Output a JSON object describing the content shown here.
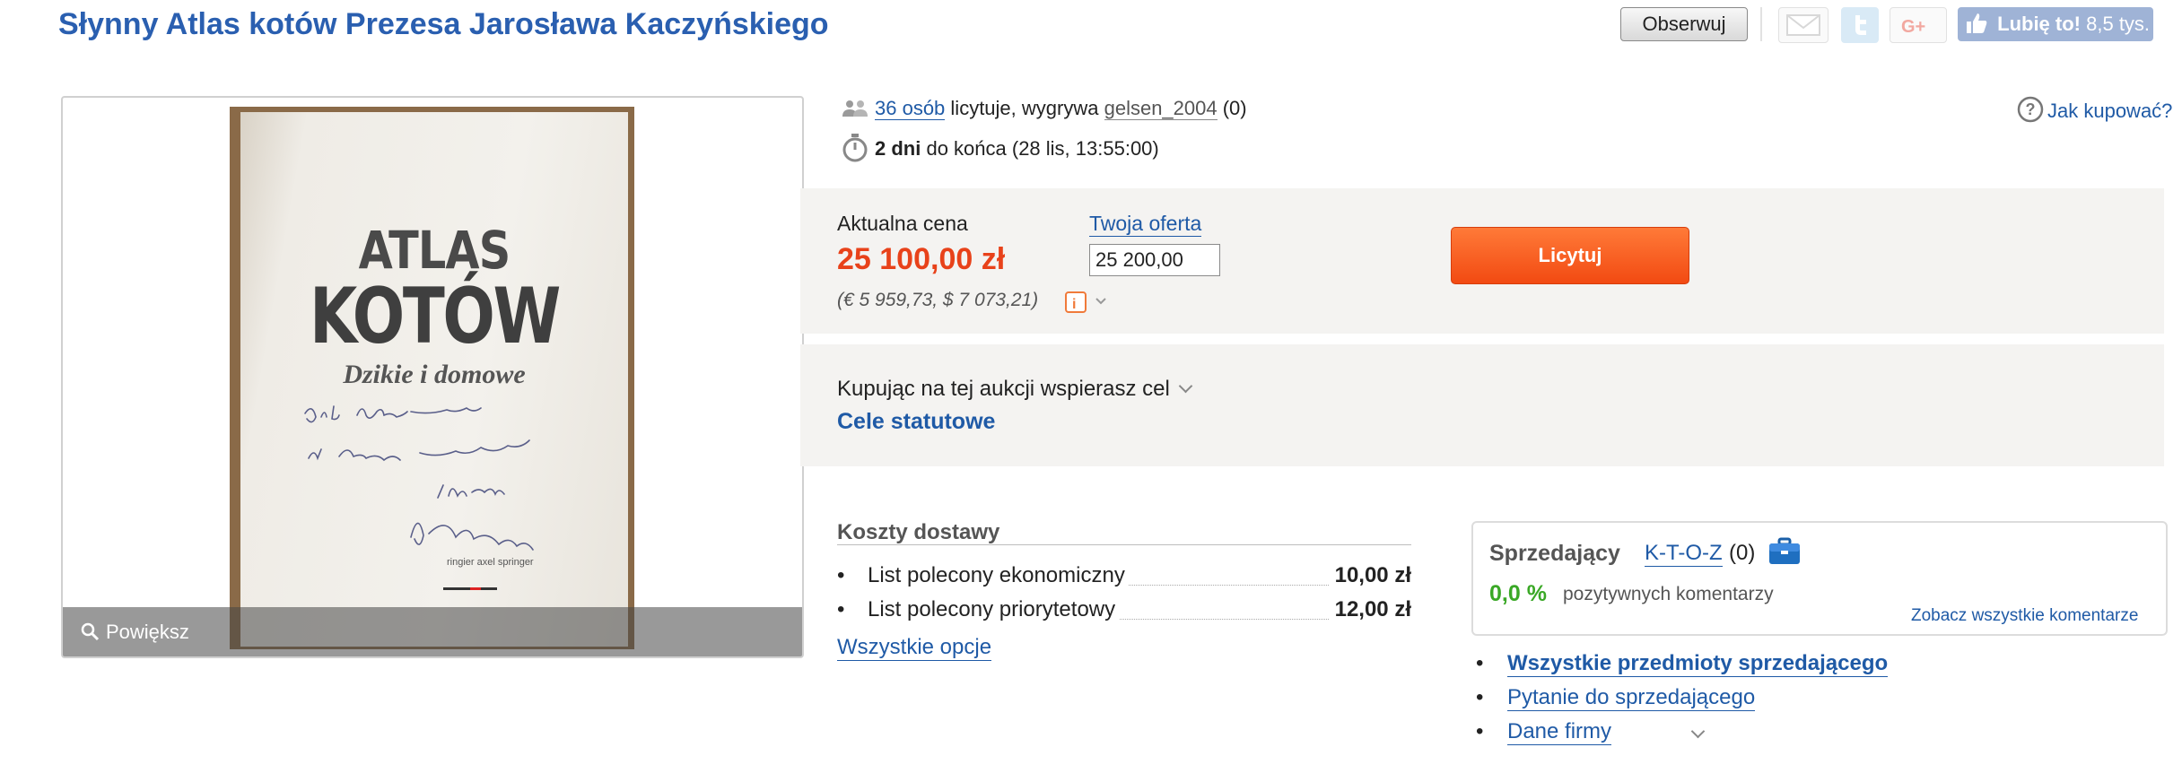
{
  "title": "Słynny Atlas kotów Prezesa Jarosława Kaczyńskiego",
  "header_actions": {
    "observe_label": "Obserwuj",
    "like_label": "Lubię to!",
    "like_count": "8,5 tys.",
    "icons": [
      "mail-icon",
      "twitter-icon",
      "google-plus-icon",
      "thumbs-up-icon"
    ]
  },
  "gallery": {
    "zoom_label": "Powiększ",
    "book_cover": {
      "line1": "ATLAS",
      "line2": "KOTÓW",
      "line3": "Dzikie i domowe",
      "publisher": "ringier axel springer"
    }
  },
  "auction": {
    "bidders_link": "36 osób",
    "bidders_text": "licytuje, wygrywa",
    "winner": "gelsen_2004",
    "winner_score": "(0)",
    "time_bold": "2 dni",
    "time_text": "do końca (28 lis, 13:55:00)",
    "how_to_buy": "Jak kupować?"
  },
  "price": {
    "current_label": "Aktualna cena",
    "current_value": "25 100,00 zł",
    "conversion": "(€ 5 959,73, $ 7 073,21)",
    "offer_label": "Twoja oferta",
    "offer_value": "25 200,00",
    "bid_button": "Licytuj"
  },
  "charity": {
    "text": "Kupując na tej aukcji wspierasz cel",
    "goal": "Cele statutowe"
  },
  "shipping": {
    "heading": "Koszty dostawy",
    "options": [
      {
        "name": "List polecony ekonomiczny",
        "price": "10,00 zł"
      },
      {
        "name": "List polecony priorytetowy",
        "price": "12,00 zł"
      }
    ],
    "all_options": "Wszystkie opcje"
  },
  "seller": {
    "label": "Sprzedający",
    "name": "K-T-O-Z",
    "score": "(0)",
    "positive_pct": "0,0 %",
    "positive_label": "pozytywnych komentarzy",
    "all_comments": "Zobacz wszystkie komentarze",
    "links": [
      "Wszystkie przedmioty sprzedającego",
      "Pytanie do sprzedającego",
      "Dane firmy"
    ]
  },
  "colors": {
    "title_blue": "#2a5fb0",
    "link_blue": "#1f5aa6",
    "price_red": "#e8421a",
    "bid_orange": "#f24a12",
    "positive_green": "#3aa826"
  }
}
